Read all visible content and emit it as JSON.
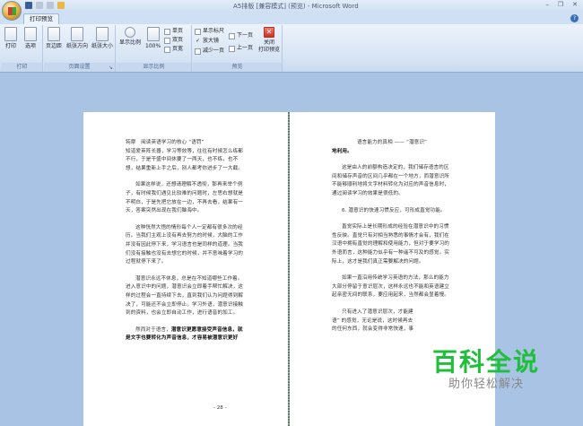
{
  "window": {
    "title": "A5排版 [兼容模式] (预览) - Microsoft Word",
    "minimize": "–",
    "restore": "❐",
    "close": "✕",
    "help": "?"
  },
  "tabs": [
    {
      "label": "打印预览"
    }
  ],
  "ribbon": {
    "groups": [
      {
        "label": "打印",
        "buttons": [
          "打印",
          "选项"
        ]
      },
      {
        "label": "页面设置",
        "buttons": [
          "页边距",
          "纸张方向",
          "纸张大小"
        ],
        "launcher": "↘"
      },
      {
        "label": "显示比例",
        "buttons": [
          "显示比例",
          "100%"
        ],
        "small": [
          "单页",
          "双页",
          "页宽"
        ]
      },
      {
        "label": "预览",
        "checks": [
          {
            "label": "显示标尺",
            "checked": false
          },
          {
            "label": "放大镜",
            "checked": true
          }
        ],
        "shrink": "减少一页",
        "next": "下一页",
        "prev": "上一页",
        "close": "关闭\n打印预览"
      }
    ]
  },
  "left_page": {
    "paragraphs": [
      "钝摩　阅读英语学习的核心 “语罚”",
      "知道爱英阵长器，学习等效等，往往有时候怎么练都不行，于是干盛中间休要了一两天，也不练，也不想，结果重新上手之后，别人都考你进步了一大截。",
      "如果这样说，还想请理解不透彻，那再来举个例子，有时候我们遇见比较难的问题时，左思右想就是不明白，于是先把它放在一边，不再去看，结果有一天，答案突然出现在我们脑海中。",
      "这种恍然大悟的情形每个人一定都有很多次的经历。当我们主观上没有再去努力的时候，大脑的工作并没有因此停下来，学习语言也是同样的道理。当我们没有接触也没有去想它的时候，并不意味着学习的过程就停下来了。",
      "潜意识永远不休息，总是在不知道哪些工作着。进入意识中的问题，潜意识会立即着手帮忙解决，这样的过程会一直持续下去，直到我们认为问题得到解决了，可能还不会立即停止。学习外语，潜意识接触到的资料，也会立即自动工作，进行语音的加工。",
      "然而对于语言，",
      "潜意识更愿意接受声音信息，就是文字也要转化为声音信息，才容易被潜意识更好"
    ],
    "page_number": "- 28 -"
  },
  "right_page": {
    "paragraphs": [
      "语言能力的真相 —— “潜意识”",
      "地利用。",
      "这是由人的前额构造决定的，我们储存语言的区间和储存声音的区间几乎都在一个地方，而潜意识所不能够顺利地将文字材料转化为对应的声音信息时，通过阅读学习的效果是很低的。",
      "6. 潜意识的快速习惯反应，可形成直觉功能。",
      "直觉实际上是长期形成的经验在潜意识中的习惯性反映。直觉只有对相当熟悉的事情才会有，我们在汉语中拥有直觉的理解和使用能力，但对于要学习的外语而言，这种能力似乎有一种遥不可及的感觉。实际上，这才是我们真正需要解决的问题。",
      "如果一直沿用传统学习英语的方法，那么的能力大部分停留于意识层次，这样永远也不能和英语建立起亲密无间的联系，要应用起来，当然都会显着慢。",
      "只有进入了潜意识层次，才能建",
      "语” 的感觉，无论是说，这时候再去",
      "的任何东西，就会变得非常快速，事"
    ]
  },
  "watermark": {
    "line1": "百科全说",
    "line2": "助你轻松解决"
  }
}
